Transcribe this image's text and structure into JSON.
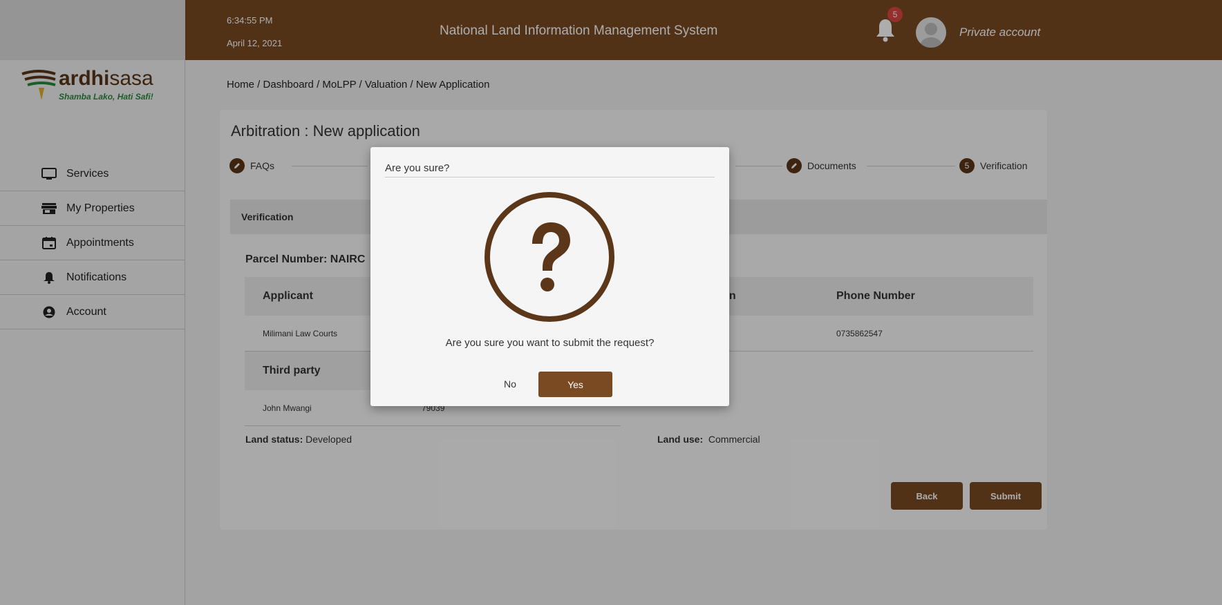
{
  "header": {
    "time": "6:34:55 PM",
    "date": "April 12, 2021",
    "title": "National Land Information Management System",
    "notification_count": "5",
    "account_label": "Private account"
  },
  "logo": {
    "brand_bold": "ardhi",
    "brand_light": "sasa",
    "tagline": "Shamba Lako, Hati Safi!"
  },
  "sidebar": {
    "items": [
      {
        "label": "Services",
        "icon": "monitor-icon"
      },
      {
        "label": "My Properties",
        "icon": "store-icon"
      },
      {
        "label": "Appointments",
        "icon": "calendar-icon"
      },
      {
        "label": "Notifications",
        "icon": "bell-icon"
      },
      {
        "label": "Account",
        "icon": "user-circle-icon"
      }
    ]
  },
  "breadcrumb": "Home / Dashboard / MoLPP / Valuation / New Application",
  "page_title": "Arbitration : New application",
  "stepper": {
    "steps": [
      {
        "label": "FAQs",
        "marker": "edit"
      },
      {
        "label": "Documents",
        "marker": "edit"
      },
      {
        "label": "Verification",
        "marker": "5"
      }
    ]
  },
  "section_title": "Verification",
  "parcel_label": "Parcel Number: NAIRC",
  "table1": {
    "headers": [
      "Applicant",
      "rson",
      "Phone Number"
    ],
    "row": [
      "Milimani Law Courts",
      "0735862547"
    ]
  },
  "table2": {
    "header": "Third party",
    "row": [
      "John Mwangi",
      "79039"
    ]
  },
  "land_status": {
    "label": "Land status:",
    "value": "Developed"
  },
  "land_use": {
    "label": "Land use:",
    "value": "Commercial"
  },
  "buttons": {
    "back": "Back",
    "submit": "Submit"
  },
  "modal": {
    "title": "Are you sure?",
    "message": "Are you sure you want to submit the request?",
    "no_label": "No",
    "yes_label": "Yes",
    "icon": "question-circle-icon"
  },
  "colors": {
    "brand_brown": "#7a4a22",
    "dark_brown": "#5b3619",
    "tag_green": "#2a8a3a"
  }
}
